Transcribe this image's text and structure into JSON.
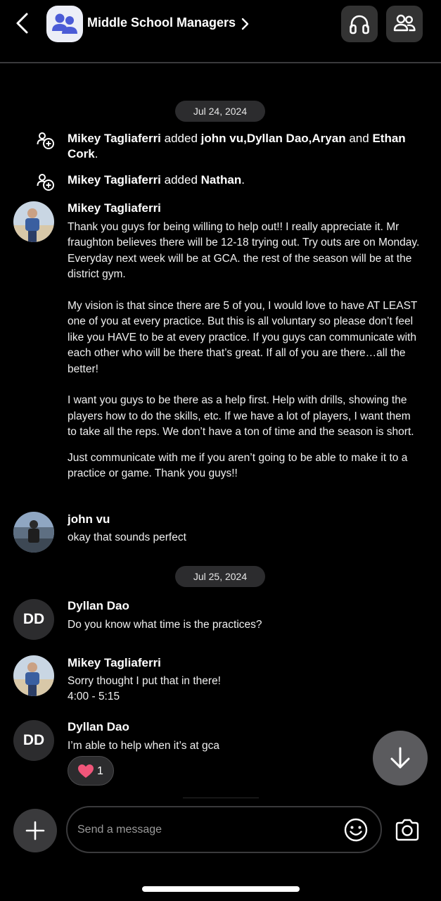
{
  "header": {
    "group_name": "Middle School Managers",
    "icons": {
      "back": "chevron-left-icon",
      "group_avatar": "group-people-icon",
      "title_arrow": "chevron-right-icon",
      "audio_call": "headphones-icon",
      "members": "people-icon"
    }
  },
  "dates": [
    "Jul 24, 2024",
    "Jul 25, 2024"
  ],
  "system_events": [
    {
      "icon": "add-person-icon",
      "actor": "Mikey Tagliaferri",
      "verb": "added",
      "targets": "john vu,Dyllan Dao,Aryan",
      "connector": "and",
      "last_target": "Ethan Cork",
      "end": "."
    },
    {
      "icon": "add-person-icon",
      "actor": "Mikey Tagliaferri",
      "verb": "added",
      "targets": "Nathan",
      "end": "."
    }
  ],
  "messages": [
    {
      "sender": "Mikey Tagliaferri",
      "avatar": "photo",
      "paragraphs": [
        "Thank you guys for being willing to help out!! I really appreciate it. Mr fraughton believes there will be 12-18 trying out. Try outs are on Monday. Everyday next week will be at GCA. the rest of the season will be at the district gym.",
        "My vision is that since there are 5 of you, I would love to have AT LEAST one of you at every practice. But this is all voluntary so please don’t feel like you HAVE to be at every practice. If you guys can communicate with each other who will be there that’s great. If all of you are there…all the better!",
        "I want you guys to be there as a help first. Help with drills, showing the players how to do the skills, etc. If we have a lot of players, I want them to take all the reps. We don’t have a ton of time and the season is short."
      ],
      "followup": "Just communicate with me if you aren’t going to be able to make it to a practice or game. Thank you guys!!"
    },
    {
      "sender": "john vu",
      "avatar": "photo",
      "text": "okay that sounds perfect"
    },
    {
      "sender": "Dyllan Dao",
      "avatar_initials": "DD",
      "text": "Do you know what time is the practices?"
    },
    {
      "sender": "Mikey Tagliaferri",
      "avatar": "photo",
      "lines": [
        "Sorry thought I put that in there!",
        "4:00 - 5:15"
      ]
    },
    {
      "sender": "Dyllan Dao",
      "avatar_initials": "DD",
      "text": "I’m able to help when it’s at gca",
      "reaction": {
        "emoji": "heart-icon",
        "count": "1"
      }
    }
  ],
  "composer": {
    "placeholder": "Send a message",
    "icons": {
      "add": "plus-icon",
      "emoji": "smiley-icon",
      "camera": "camera-icon",
      "scroll": "arrow-down-icon"
    }
  },
  "colors": {
    "background": "#000000",
    "bubble_gray": "#2c2c2e",
    "group_icon": "#4b5bd6",
    "heart": "#f0567a"
  }
}
